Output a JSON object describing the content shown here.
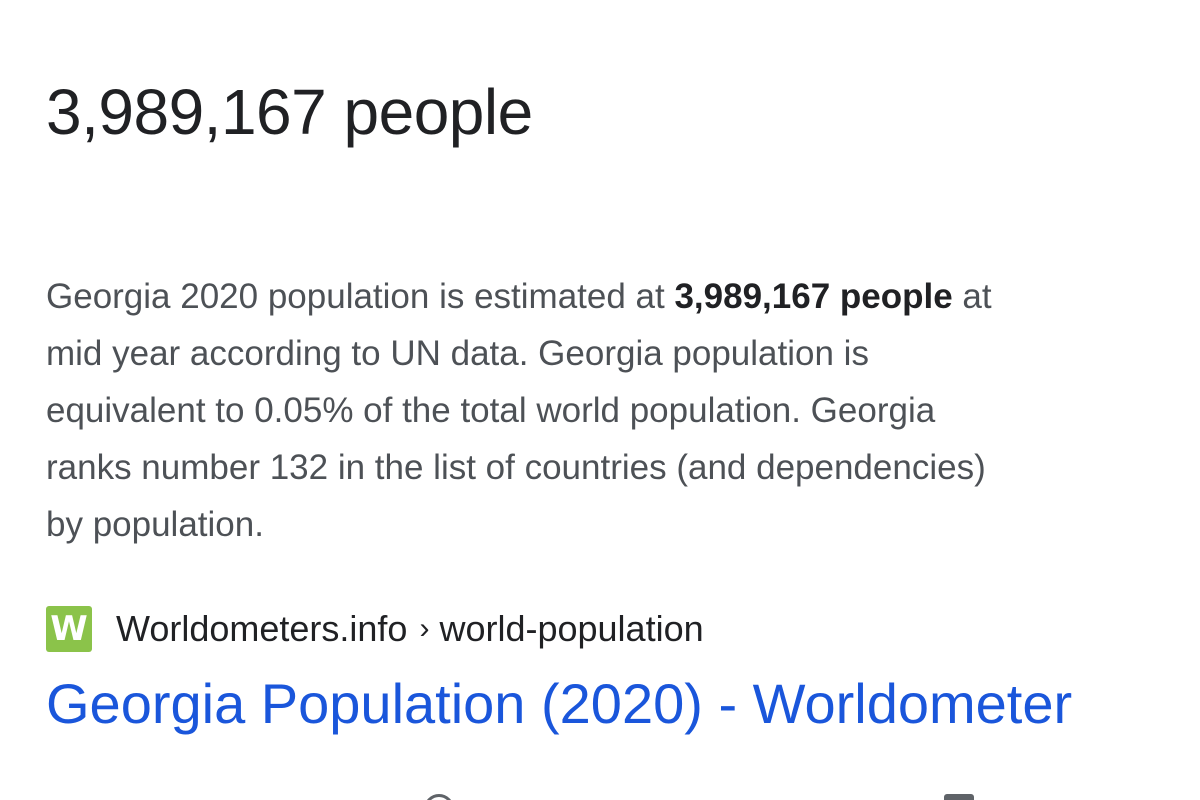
{
  "answer": {
    "value": "3,989,167 people"
  },
  "snippet": {
    "line1_pre": "Georgia 2020 population is estimated at ",
    "line1_bold": "3,989,167 people",
    "line1_post": " at",
    "line2": "mid year according to UN data. Georgia population is",
    "line3": "equivalent to 0.05% of the total world population. Georgia",
    "line4": "ranks number 132 in the list of countries (and dependencies)",
    "line5": "by population."
  },
  "source": {
    "favicon_letter": "W",
    "site": "Worldometers.info",
    "separator": "›",
    "path": "world-population"
  },
  "result": {
    "title": "Georgia Population (2020) - Worldometer"
  },
  "colors": {
    "link": "#1a56db",
    "favicon": "#8bc34a",
    "body_text": "#4d5156"
  },
  "icons": [
    "cut-off-icon",
    "cut-off-icon"
  ]
}
